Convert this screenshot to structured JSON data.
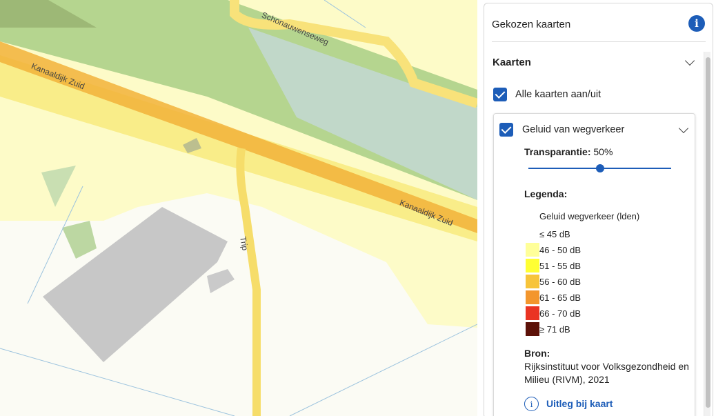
{
  "map": {
    "streets": [
      {
        "name": "Schonauwenseweg"
      },
      {
        "name": "Kanaaldijk Zuid"
      },
      {
        "name": "Kanaaldijk Zuid"
      },
      {
        "name": "Trip"
      }
    ]
  },
  "panel": {
    "title": "Gekozen kaarten",
    "info_icon": "info-icon",
    "section": {
      "title": "Kaarten",
      "toggle_all_label": "Alle kaarten aan/uit",
      "toggle_all_checked": true
    },
    "layer": {
      "name": "Geluid van wegverkeer",
      "checked": true,
      "transparency_label": "Transparantie:",
      "transparency_value": "50%",
      "transparency_fraction": 0.5,
      "legend_title": "Legenda:",
      "legend_heading": "Geluid wegverkeer (lden)",
      "legend_items": [
        {
          "label": "≤ 45 dB",
          "color": "#ffffff"
        },
        {
          "label": "46 - 50 dB",
          "color": "#ffff99"
        },
        {
          "label": "51 - 55 dB",
          "color": "#ffff33"
        },
        {
          "label": "56 - 60 dB",
          "color": "#f7c43a"
        },
        {
          "label": "61 - 65 dB",
          "color": "#f3962d"
        },
        {
          "label": "66 - 70 dB",
          "color": "#ea3423"
        },
        {
          "label": "≥ 71 dB",
          "color": "#5c1108"
        }
      ],
      "source_title": "Bron:",
      "source_text": "Rijksinstituut voor Volksgezondheid en Milieu (RIVM), 2021",
      "explain_link": "Uitleg bij kaart",
      "explain_icon": "info-circle-icon"
    }
  },
  "colors": {
    "accent": "#1d5db8",
    "map_green": "#aed58a",
    "map_water": "#c0dbd0"
  }
}
